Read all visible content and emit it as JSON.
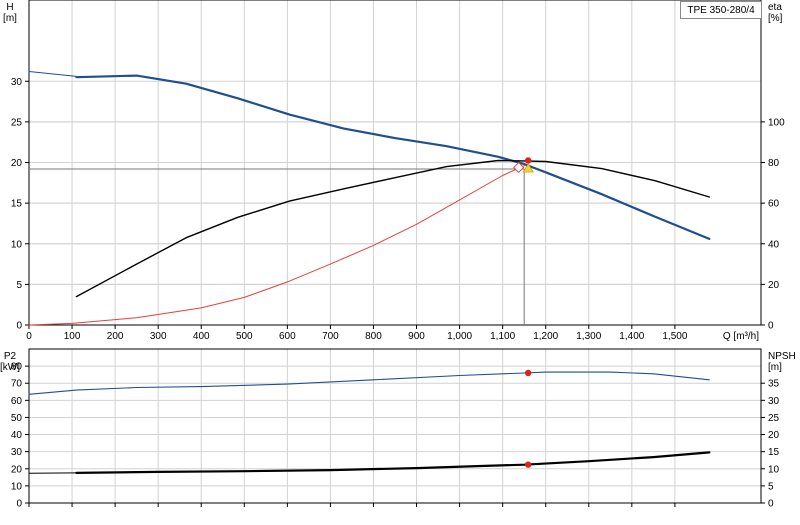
{
  "pump_model": "TPE 350-280/4",
  "chart_data": [
    {
      "id": "main",
      "type": "line",
      "xlabel": "Q [m³/h]",
      "xlim": [
        0,
        1700
      ],
      "x_ticks": [
        0,
        100,
        200,
        300,
        400,
        500,
        600,
        700,
        800,
        900,
        1000,
        1100,
        1200,
        1300,
        1400,
        1500
      ],
      "x_tick_labels": [
        "0",
        "100",
        "200",
        "300",
        "400",
        "500",
        "600",
        "700",
        "800",
        "900",
        "1,000",
        "1,100",
        "1,200",
        "1,300",
        "1,400",
        "1,500"
      ],
      "left_axis": {
        "label_line1": "H",
        "label_line2": "[m]",
        "lim": [
          0,
          40
        ],
        "ticks": [
          0,
          5,
          10,
          15,
          20,
          25,
          30
        ]
      },
      "right_axis": {
        "label_line1": "eta",
        "label_line2": "[%]",
        "lim": [
          0,
          160
        ],
        "ticks": [
          0,
          20,
          40,
          60,
          80,
          100
        ]
      },
      "grid": true,
      "series": [
        {
          "key": "head_max",
          "axis": "left",
          "color": "#1f4f8f",
          "width": 1,
          "x": [
            0,
            110
          ],
          "y": [
            31.2,
            30.6
          ]
        },
        {
          "key": "head",
          "axis": "left",
          "color": "#1f4f8f",
          "width": 2.2,
          "x": [
            110,
            250,
            365,
            485,
            605,
            730,
            850,
            970,
            1090,
            1150,
            1200,
            1330,
            1455,
            1580
          ],
          "y": [
            30.5,
            30.7,
            29.7,
            27.9,
            25.9,
            24.2,
            23.0,
            22.0,
            20.7,
            19.8,
            18.8,
            16.1,
            13.3,
            10.6
          ]
        },
        {
          "key": "efficiency",
          "axis": "right",
          "color": "#000000",
          "width": 1.4,
          "x": [
            110,
            250,
            365,
            485,
            605,
            730,
            850,
            970,
            1090,
            1150,
            1200,
            1330,
            1455,
            1580
          ],
          "y": [
            14,
            30,
            43,
            53,
            61,
            67,
            72.5,
            78,
            81,
            80.8,
            80.5,
            77,
            71,
            63
          ]
        },
        {
          "key": "system",
          "axis": "left",
          "color": "#e8403a",
          "width": 1,
          "x": [
            0,
            100,
            250,
            400,
            500,
            600,
            700,
            800,
            900,
            1000,
            1100,
            1150
          ],
          "y": [
            0,
            0.2,
            0.9,
            2.1,
            3.4,
            5.3,
            7.5,
            9.8,
            12.4,
            15.4,
            18.4,
            19.6
          ]
        }
      ],
      "duty_point": {
        "x": 1150,
        "y": 19.2,
        "eff": 81
      }
    },
    {
      "id": "lower",
      "type": "line",
      "xlim": [
        0,
        1700
      ],
      "x_ticks": [
        0,
        100,
        200,
        300,
        400,
        500,
        600,
        700,
        800,
        900,
        1000,
        1100,
        1200,
        1300,
        1400,
        1500
      ],
      "left_axis": {
        "label_line1": "P2",
        "label_line2": "[kW]",
        "lim": [
          0,
          90
        ],
        "ticks": [
          0,
          10,
          20,
          30,
          40,
          50,
          60,
          70,
          80
        ]
      },
      "right_axis": {
        "label_line1": "NPSH",
        "label_line2": "[m]",
        "lim": [
          0,
          45
        ],
        "ticks": [
          0,
          5,
          10,
          15,
          20,
          25,
          30,
          35
        ]
      },
      "grid": true,
      "series": [
        {
          "key": "power",
          "axis": "left",
          "color": "#1f4f8f",
          "width": 1.1,
          "x": [
            0,
            110,
            250,
            400,
            600,
            800,
            1000,
            1150,
            1200,
            1350,
            1450,
            1580
          ],
          "y": [
            63.5,
            66,
            67.5,
            68,
            69.5,
            72,
            74.5,
            76,
            76.5,
            76.5,
            75.5,
            72
          ]
        },
        {
          "key": "npsh",
          "axis": "right",
          "color": "#000000",
          "width": 1,
          "x": [
            0,
            110
          ],
          "y": [
            8.7,
            8.8
          ]
        },
        {
          "key": "npsh_bold",
          "axis": "right",
          "color": "#000000",
          "width": 2.2,
          "x": [
            110,
            300,
            500,
            700,
            900,
            1050,
            1150,
            1300,
            1450,
            1580
          ],
          "y": [
            8.8,
            9.1,
            9.3,
            9.6,
            10.2,
            10.8,
            11.2,
            12.2,
            13.4,
            14.8
          ]
        }
      ],
      "markers": [
        {
          "axis": "left",
          "x": 1150,
          "y": 76,
          "color": "#e0201a"
        },
        {
          "axis": "right",
          "x": 1150,
          "y": 11.2,
          "color": "#e0201a"
        }
      ]
    }
  ]
}
